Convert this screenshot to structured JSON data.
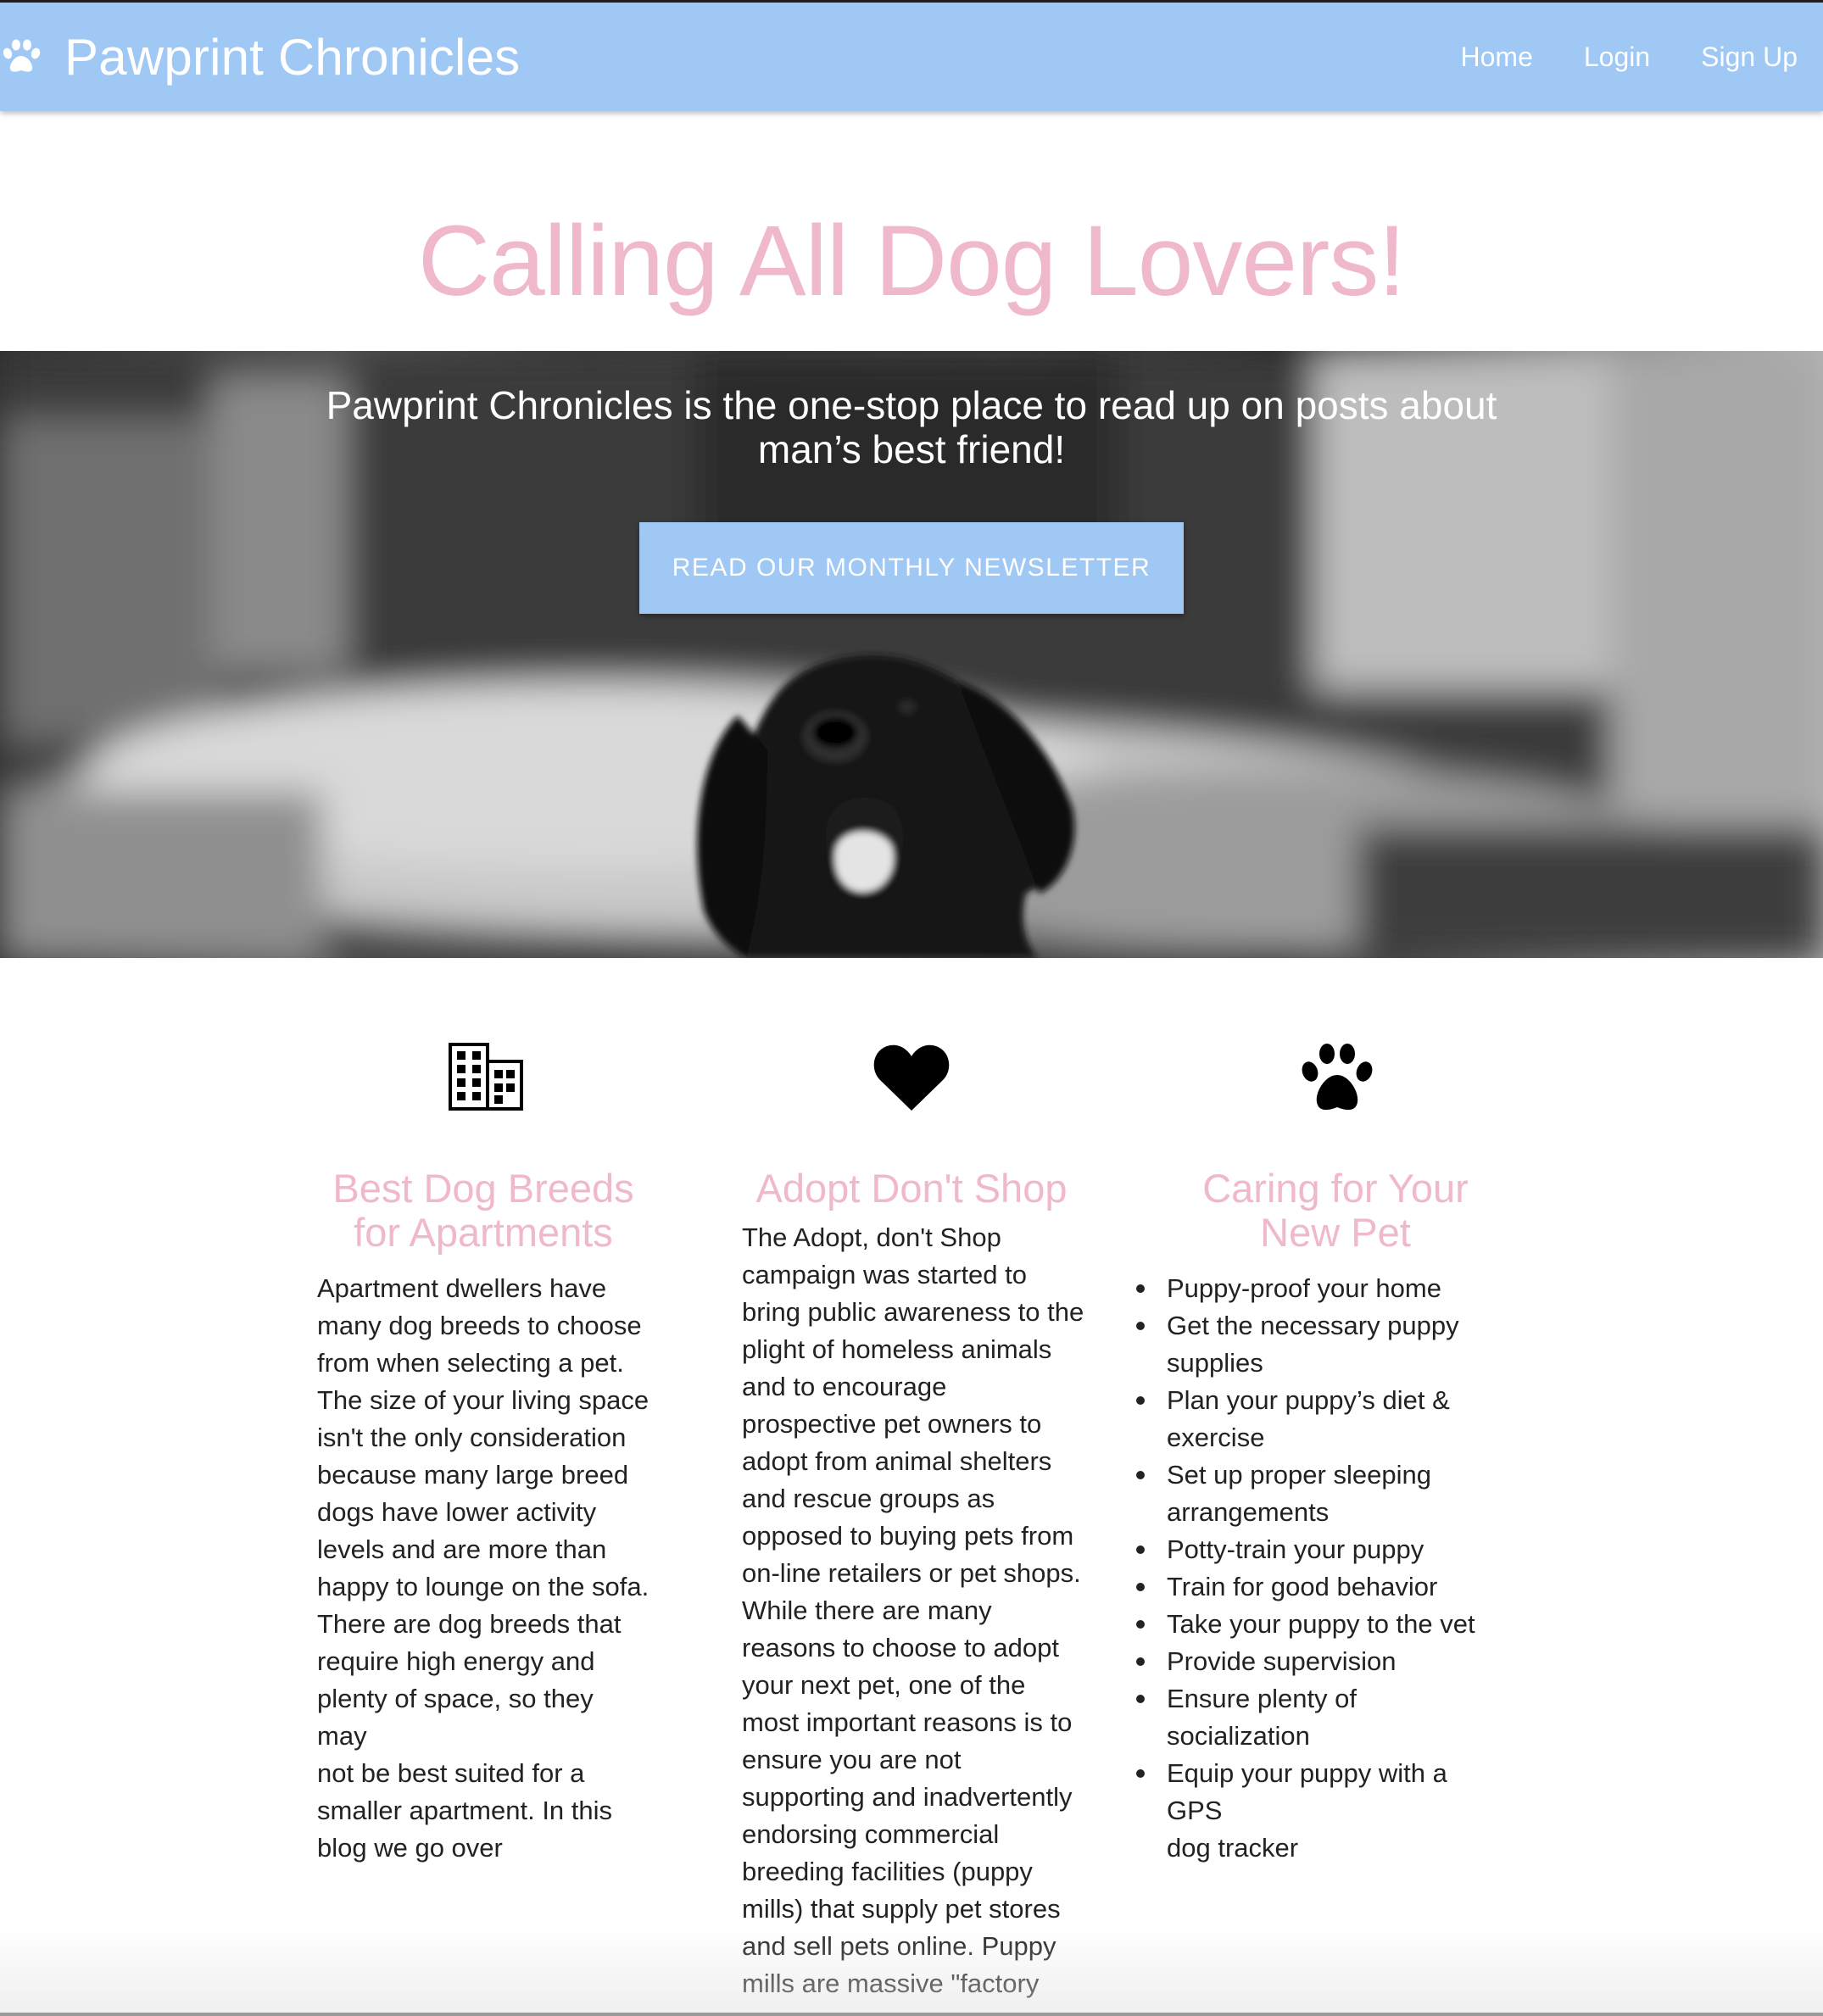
{
  "navbar": {
    "brand_icon": "paw-icon",
    "brand_name": "Pawprint Chronicles",
    "links": [
      {
        "label": "Home"
      },
      {
        "label": "Login"
      },
      {
        "label": "Sign Up"
      }
    ]
  },
  "hero": {
    "title": "Calling All Dog Lovers!",
    "tagline_line1": "Pawprint Chronicles is the one-stop place to read up on posts about",
    "tagline_line2": "man’s best friend!",
    "button_label": "READ OUR MONTHLY NEWSLETTER"
  },
  "features": [
    {
      "icon": "building-icon",
      "title_line1": "Best Dog Breeds",
      "title_line2": "for Apartments",
      "lines": [
        "Apartment dwellers have",
        "many dog breeds to choose",
        "from when selecting a pet.",
        "The size of your living space",
        "isn't the only consideration",
        "because many large breed",
        "dogs have lower activity",
        "levels and are more than",
        "happy to lounge on the sofa.",
        "There are dog breeds that",
        "require high energy and",
        "plenty of space, so they may",
        "not be best suited for a",
        "smaller apartment. In this",
        "blog we go over"
      ]
    },
    {
      "icon": "heart-icon",
      "title_line1": "Adopt Don't Shop",
      "lines": [
        "The Adopt, don't Shop",
        "campaign was started to",
        "bring public awareness to the",
        "plight of homeless animals",
        "and to encourage",
        "prospective pet owners to",
        "adopt from animal shelters",
        "and rescue groups as",
        "opposed to buying pets from",
        "on-line retailers or pet shops.",
        "While there are many",
        "reasons to choose to adopt",
        "your next pet, one of the",
        "most important reasons is to",
        "ensure you are not",
        "supporting and inadvertently",
        "endorsing commercial",
        "breeding facilities (puppy",
        "mills) that supply pet stores",
        "and sell pets online. Puppy",
        "mills are massive \"factory"
      ]
    },
    {
      "icon": "paw-icon",
      "title_line1": "Caring for Your",
      "title_line2": "New Pet",
      "list": [
        [
          "Puppy-proof your home"
        ],
        [
          "Get the necessary puppy",
          "supplies"
        ],
        [
          "Plan your puppy’s diet &",
          "exercise"
        ],
        [
          "Set up proper sleeping",
          "arrangements"
        ],
        [
          "Potty-train your puppy"
        ],
        [
          "Train for good behavior"
        ],
        [
          "Take your puppy to the vet"
        ],
        [
          "Provide supervision"
        ],
        [
          "Ensure plenty of",
          "socialization"
        ],
        [
          "Equip your puppy with a GPS",
          "dog tracker"
        ]
      ]
    }
  ]
}
